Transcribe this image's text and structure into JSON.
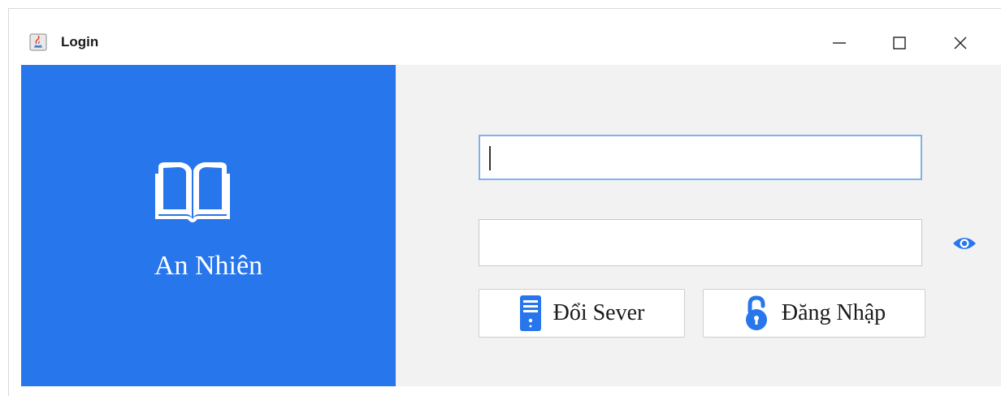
{
  "window": {
    "title": "Login",
    "controls": {
      "minimize_icon": "minimize-icon",
      "maximize_icon": "maximize-icon",
      "close_icon": "close-icon"
    }
  },
  "brand": {
    "name": "An Nhiên",
    "icon": "open-book-icon",
    "panel_color": "#2776ec"
  },
  "form": {
    "username": {
      "value": "",
      "placeholder": ""
    },
    "password": {
      "value": "",
      "placeholder": ""
    },
    "show_password_icon": "eye-icon"
  },
  "buttons": {
    "change_server": {
      "label": "Đổi Sever",
      "icon": "server-icon",
      "icon_color": "#2776ec"
    },
    "login": {
      "label": "Đăng Nhập",
      "icon": "unlock-icon",
      "icon_color": "#2776ec"
    }
  }
}
